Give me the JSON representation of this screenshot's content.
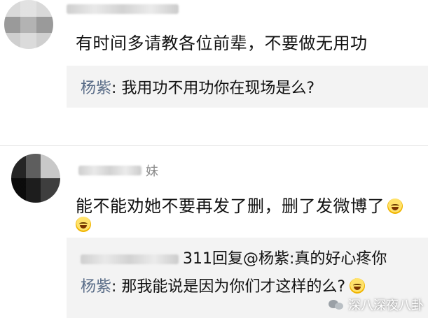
{
  "comments": [
    {
      "username_visible": "",
      "text": "有时间多请教各位前辈，不要做无用功",
      "reply": {
        "lines": [
          {
            "name": "杨紫",
            "text": ": 我用功不用功你在现场是么?"
          }
        ]
      }
    },
    {
      "username_visible": "妹",
      "text": "能不能劝她不要再发了删，删了发微博了",
      "reply": {
        "lines": [
          {
            "name": "",
            "text": "311回复@杨紫:真的好心疼你"
          },
          {
            "name": "杨紫",
            "text": ": 那我能说是因为你们才这样的么?"
          }
        ]
      }
    }
  ],
  "watermark": {
    "text": "深八深夜八卦"
  },
  "colors": {
    "reply_bg": "#f3f3f3",
    "reply_name": "#5a6d88",
    "divider": "#e6e6e6"
  },
  "icons": {
    "avatar": "blurred-avatar",
    "emoji": "laughing-emoji",
    "watermark": "wechat-icon"
  }
}
